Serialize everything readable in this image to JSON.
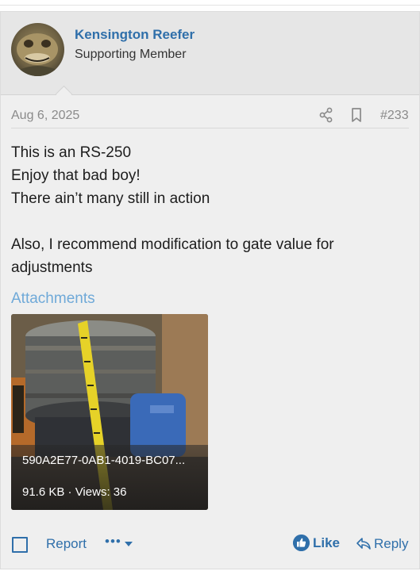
{
  "post": {
    "author": {
      "name": "Kensington Reefer",
      "title": "Supporting Member"
    },
    "date": "Aug 6, 2025",
    "number": "#233",
    "body": [
      "This is an RS-250",
      "Enjoy that bad boy!",
      "There ain’t many still in action",
      "",
      "Also, I recommend modification to gate value for adjustments"
    ],
    "attachments": {
      "title": "Attachments",
      "items": [
        {
          "filename": "590A2E77-0AB1-4019-BC07...",
          "meta": "91.6 KB · Views: 36"
        }
      ]
    },
    "actions": {
      "report": "Report",
      "more": "•••",
      "like": "Like",
      "reply": "Reply"
    }
  },
  "colors": {
    "link": "#2f6faa",
    "attachments_title": "#6fa9d8",
    "meta_text": "#8a8a8a",
    "post_background": "#efefef",
    "header_background": "#e6e6e6"
  },
  "icons": [
    "share-icon",
    "bookmark-icon",
    "select-checkbox-icon",
    "caret-down-icon",
    "thumbs-up-icon",
    "reply-arrow-icon"
  ]
}
